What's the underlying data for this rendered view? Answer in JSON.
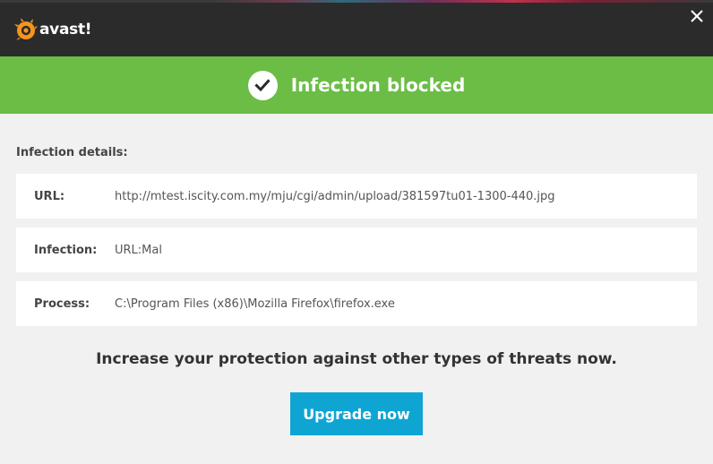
{
  "titlebar": {
    "logo_text": "avast!",
    "logo_icon": "avast-orb-icon",
    "close_icon": "close-icon"
  },
  "banner": {
    "title": "Infection blocked",
    "icon": "checkmark-icon",
    "color": "#6bbd46"
  },
  "details": {
    "section_label": "Infection details:",
    "rows": [
      {
        "label": "URL:",
        "value": "http://mtest.iscity.com.my/mju/cgi/admin/upload/381597tu01-1300-440.jpg"
      },
      {
        "label": "Infection:",
        "value": "URL:Mal"
      },
      {
        "label": "Process:",
        "value": "C:\\Program Files (x86)\\Mozilla Firefox\\firefox.exe"
      }
    ]
  },
  "promo": {
    "text": "Increase your protection against other types of threats now."
  },
  "upgrade": {
    "label": "Upgrade now",
    "color": "#0fa5d3"
  }
}
